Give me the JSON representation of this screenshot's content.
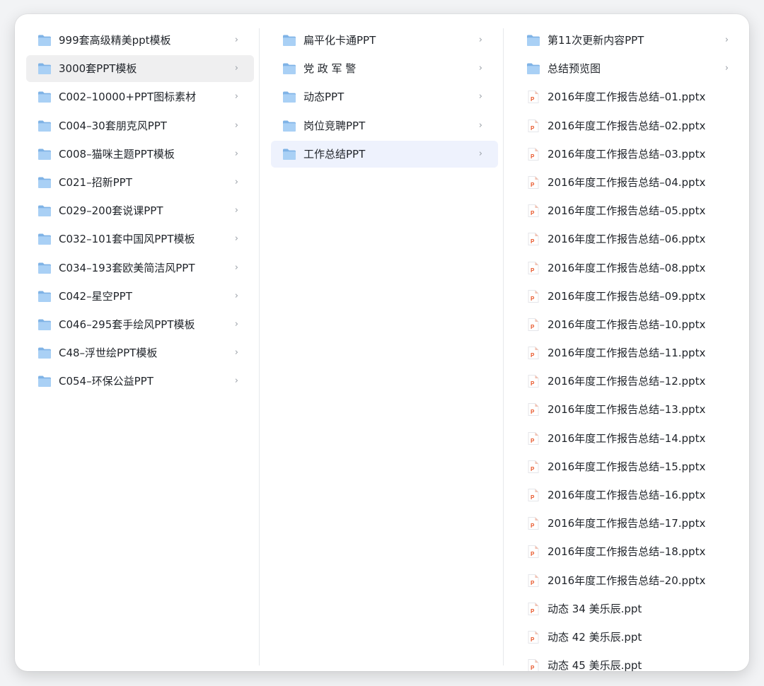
{
  "columns": [
    {
      "items": [
        {
          "label": "999套高级精美ppt模板",
          "type": "folder",
          "has_children": true
        },
        {
          "label": "3000套PPT模板",
          "type": "folder",
          "has_children": true,
          "state": "hover"
        },
        {
          "label": "C002–10000+PPT图标素材",
          "type": "folder",
          "has_children": true
        },
        {
          "label": "C004–30套朋克风PPT",
          "type": "folder",
          "has_children": true
        },
        {
          "label": "C008–猫咪主题PPT模板",
          "type": "folder",
          "has_children": true
        },
        {
          "label": "C021–招新PPT",
          "type": "folder",
          "has_children": true
        },
        {
          "label": "C029–200套说课PPT",
          "type": "folder",
          "has_children": true
        },
        {
          "label": "C032–101套中国风PPT模板",
          "type": "folder",
          "has_children": true
        },
        {
          "label": "C034–193套欧美简洁风PPT",
          "type": "folder",
          "has_children": true
        },
        {
          "label": "C042–星空PPT",
          "type": "folder",
          "has_children": true
        },
        {
          "label": "C046–295套手绘风PPT模板",
          "type": "folder",
          "has_children": true
        },
        {
          "label": "C48–浮世绘PPT模板",
          "type": "folder",
          "has_children": true
        },
        {
          "label": "C054–环保公益PPT",
          "type": "folder",
          "has_children": true
        }
      ]
    },
    {
      "items": [
        {
          "label": "扁平化卡通PPT",
          "type": "folder",
          "has_children": true
        },
        {
          "label": "党 政 军 警",
          "type": "folder",
          "has_children": true
        },
        {
          "label": "动态PPT",
          "type": "folder",
          "has_children": true
        },
        {
          "label": "岗位竞聘PPT",
          "type": "folder",
          "has_children": true
        },
        {
          "label": "工作总结PPT",
          "type": "folder",
          "has_children": true,
          "state": "selected"
        }
      ]
    },
    {
      "items": [
        {
          "label": "第11次更新内容PPT",
          "type": "folder",
          "has_children": true
        },
        {
          "label": "总结预览图",
          "type": "folder",
          "has_children": true
        },
        {
          "label": "2016年度工作报告总结–01.pptx",
          "type": "ppt"
        },
        {
          "label": "2016年度工作报告总结–02.pptx",
          "type": "ppt"
        },
        {
          "label": "2016年度工作报告总结–03.pptx",
          "type": "ppt"
        },
        {
          "label": "2016年度工作报告总结–04.pptx",
          "type": "ppt"
        },
        {
          "label": "2016年度工作报告总结–05.pptx",
          "type": "ppt"
        },
        {
          "label": "2016年度工作报告总结–06.pptx",
          "type": "ppt"
        },
        {
          "label": "2016年度工作报告总结–08.pptx",
          "type": "ppt"
        },
        {
          "label": "2016年度工作报告总结–09.pptx",
          "type": "ppt"
        },
        {
          "label": "2016年度工作报告总结–10.pptx",
          "type": "ppt"
        },
        {
          "label": "2016年度工作报告总结–11.pptx",
          "type": "ppt"
        },
        {
          "label": "2016年度工作报告总结–12.pptx",
          "type": "ppt"
        },
        {
          "label": "2016年度工作报告总结–13.pptx",
          "type": "ppt"
        },
        {
          "label": "2016年度工作报告总结–14.pptx",
          "type": "ppt"
        },
        {
          "label": "2016年度工作报告总结–15.pptx",
          "type": "ppt"
        },
        {
          "label": "2016年度工作报告总结–16.pptx",
          "type": "ppt"
        },
        {
          "label": "2016年度工作报告总结–17.pptx",
          "type": "ppt"
        },
        {
          "label": "2016年度工作报告总结–18.pptx",
          "type": "ppt"
        },
        {
          "label": "2016年度工作报告总结–20.pptx",
          "type": "ppt"
        },
        {
          "label": "动态 34 美乐辰.ppt",
          "type": "ppt"
        },
        {
          "label": "动态 42 美乐辰.ppt",
          "type": "ppt"
        },
        {
          "label": "动态 45 美乐辰.ppt",
          "type": "ppt"
        }
      ]
    }
  ],
  "icons": {
    "folder": "folder-icon",
    "ppt": "ppt-file-icon",
    "chevron": "chevron-right-icon"
  },
  "chevron_glyph": "›",
  "colors": {
    "folder_back": "#7fb3e6",
    "folder_front": "#a9d0f5",
    "ppt_accent": "#e8572a",
    "selected_row": "#eef2fd",
    "hover_row": "#efeff0",
    "text": "#1f2329"
  }
}
